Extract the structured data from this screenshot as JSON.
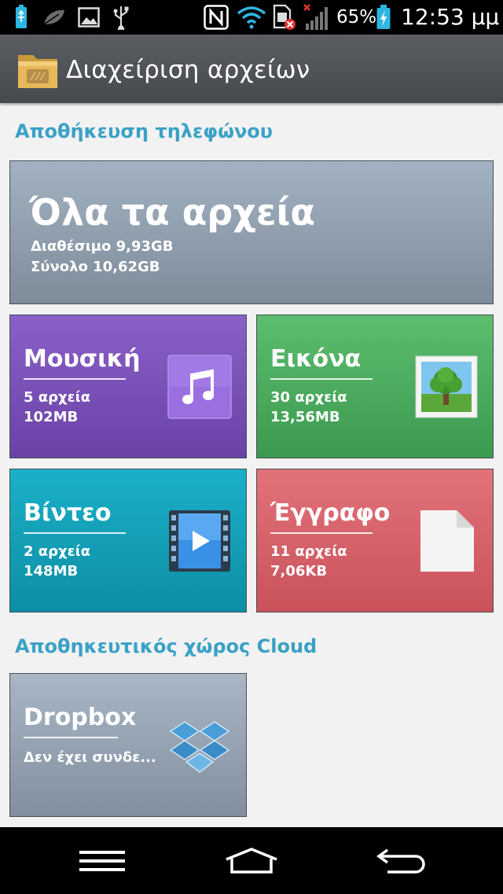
{
  "status_bar": {
    "battery_percent": "65%",
    "time": "12:53 μμ",
    "icons": [
      "usb-battery-icon",
      "leaf-icon",
      "image-icon",
      "usb-icon",
      "nfc-icon",
      "wifi-icon",
      "sim-icon",
      "signal-icon",
      "battery-charging-icon"
    ]
  },
  "app_bar": {
    "title": "Διαχείριση αρχείων",
    "icon": "folder-icon"
  },
  "sections": {
    "phone_storage": "Αποθήκευση τηλεφώνου",
    "cloud_storage": "Αποθηκευτικός χώρος Cloud"
  },
  "all_files": {
    "title": "Όλα τα αρχεία",
    "available": "Διαθέσιμο 9,93GB",
    "total": "Σύνολο 10,62GB"
  },
  "categories": [
    {
      "title": "Μουσική",
      "count": "5 αρχεία",
      "size": "102MB",
      "icon": "music-note-icon",
      "color": "#7a52b8"
    },
    {
      "title": "Εικόνα",
      "count": "30 αρχεία",
      "size": "13,56MB",
      "icon": "tree-picture-icon",
      "color": "#4cab5e"
    },
    {
      "title": "Βίντεο",
      "count": "2 αρχεία",
      "size": "148MB",
      "icon": "film-play-icon",
      "color": "#139fb7"
    },
    {
      "title": "Έγγραφο",
      "count": "11 αρχεία",
      "size": "7,06KB",
      "icon": "document-icon",
      "color": "#d6626a"
    }
  ],
  "cloud": {
    "title": "Dropbox",
    "status": "Δεν έχει συνδε...",
    "icon": "dropbox-icon"
  },
  "nav": {
    "icons": [
      "menu-icon",
      "home-icon",
      "back-icon"
    ]
  },
  "colors": {
    "accent": "#3aa1c6",
    "titlebar": "#505458"
  }
}
